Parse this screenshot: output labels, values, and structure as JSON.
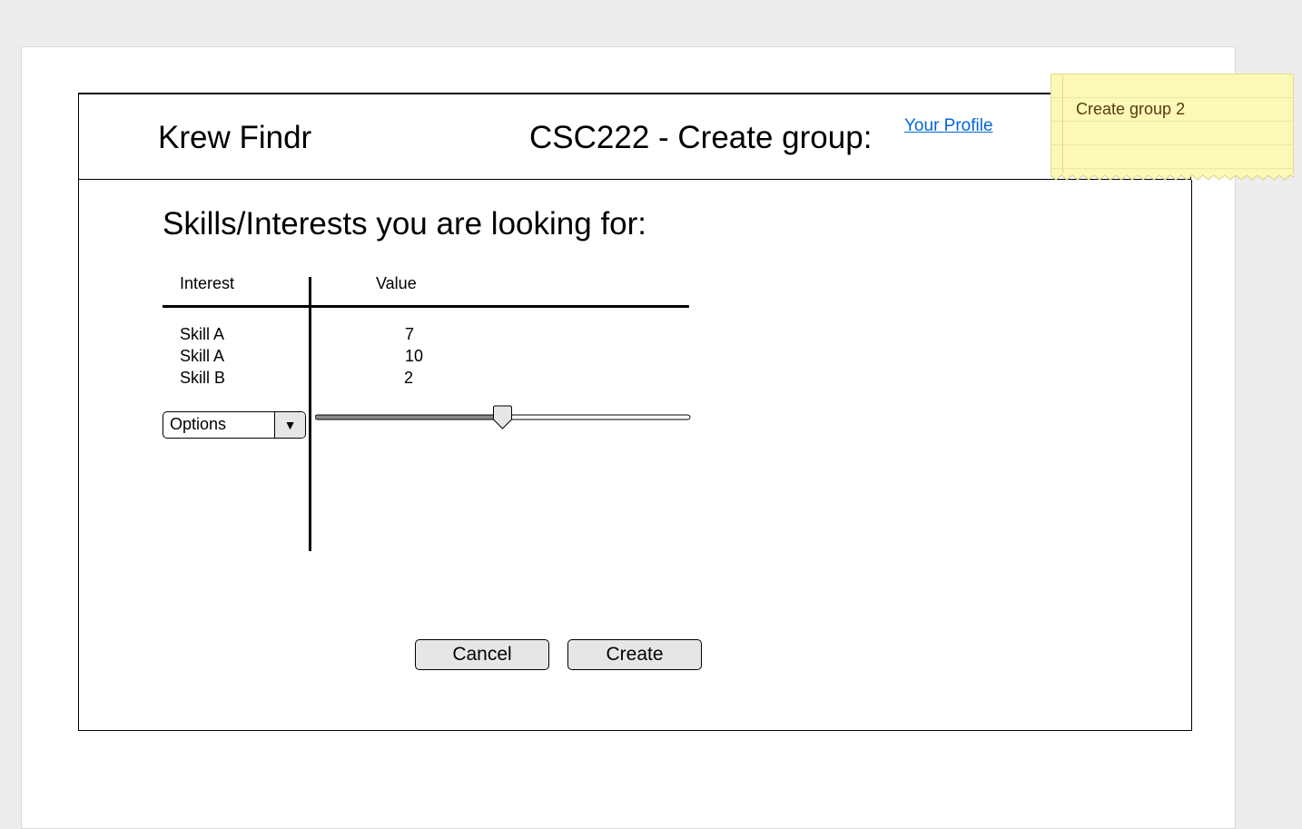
{
  "header": {
    "app_title": "Krew Findr",
    "page_title": "CSC222 - Create group:",
    "profile_link": "Your Profile"
  },
  "sticky_note": {
    "text": "Create group 2",
    "color": "#fcf8b6"
  },
  "section": {
    "title": "Skills/Interests you are looking for:"
  },
  "table": {
    "columns": [
      "Interest",
      "Value"
    ],
    "rows": [
      {
        "interest": "Skill A",
        "value": "7"
      },
      {
        "interest": "Skill A",
        "value": "10"
      },
      {
        "interest": "Skill B",
        "value": "2"
      }
    ]
  },
  "controls": {
    "dropdown_selected": "Options",
    "dropdown_icon": "triangle-down-icon",
    "slider_level": 0.5
  },
  "buttons": {
    "cancel": "Cancel",
    "create": "Create"
  },
  "colors": {
    "link": "#0066dd",
    "button_bg": "#e6e6e6"
  }
}
